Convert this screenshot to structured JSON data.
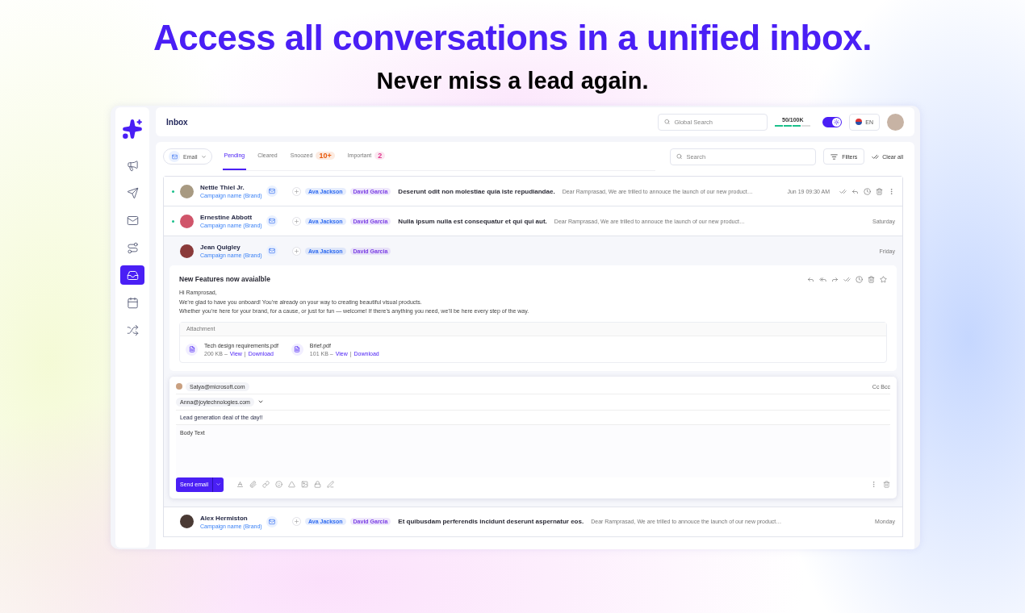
{
  "headline": "Access all conversations in a unified inbox.",
  "subheadline": "Never miss a lead again.",
  "sidebar": {
    "items": [
      {
        "kind": "megaphone",
        "selected": false
      },
      {
        "kind": "send",
        "selected": false
      },
      {
        "kind": "mail",
        "selected": false
      },
      {
        "kind": "route",
        "selected": false
      },
      {
        "kind": "inbox",
        "selected": true
      },
      {
        "kind": "calendar",
        "selected": false
      },
      {
        "kind": "shuffle",
        "selected": false
      }
    ]
  },
  "topbar": {
    "title": "Inbox",
    "search": {
      "placeholder": "Global Search"
    },
    "usage": {
      "reading": "50/100K",
      "level": 0.75
    },
    "toggle": {
      "on": true
    },
    "language": "EN"
  },
  "toolbar": {
    "channel": "Email",
    "tabs": [
      {
        "label": "Pending",
        "selected": true
      },
      {
        "label": "Cleared",
        "selected": false
      },
      {
        "label": "Snoozed",
        "selected": false,
        "badge": "10+",
        "color": "#e8590c"
      },
      {
        "label": "Important",
        "selected": false,
        "badge": "2",
        "color": "#e0368c"
      }
    ],
    "search": {
      "placeholder": "Search"
    },
    "filters": "Filters",
    "clear": "Clear all"
  },
  "messages": [
    {
      "name": "Nettie Thiel Jr.",
      "campaign": "Campaign name (Brand)",
      "unread": true,
      "hovered": true,
      "expanded": false,
      "tags": [
        {
          "label": "Ava Jackson",
          "color": "#2f6bf0"
        },
        {
          "label": "David Garcia",
          "color": "#7b3fe4"
        }
      ],
      "subject": "Deserunt odit non molestiae quia iste repudiandae.",
      "preview": "Dear Ramprasad, We are trilled to annouce the launch of our new product…",
      "time": "Jun 19  09:30 AM"
    },
    {
      "name": "Ernestine Abbott",
      "campaign": "Campaign name (Brand)",
      "unread": true,
      "hovered": false,
      "expanded": false,
      "tags": [
        {
          "label": "Ava Jackson",
          "color": "#2f6bf0"
        },
        {
          "label": "David Garcia",
          "color": "#7b3fe4"
        }
      ],
      "subject": "Nulla ipsum nulla est consequatur et qui qui aut.",
      "preview": "Dear Ramprasad, We are trilled to annouce the launch of our new product…",
      "time": "Saturday"
    },
    {
      "name": "Jean Quigley",
      "campaign": "Campaign name (Brand)",
      "unread": false,
      "hovered": false,
      "expanded": true,
      "tags": [
        {
          "label": "Ava Jackson",
          "color": "#2f6bf0"
        },
        {
          "label": "David Garcia",
          "color": "#7b3fe4"
        }
      ],
      "time": "Friday",
      "detail": {
        "subject": "New Features now avaialble",
        "body": [
          "Hi Ramprosad,",
          "We’re glad to have you onboard! You’re already on your way to creating beautiful visual products.",
          "Whether you’re here for your brand, for a cause, or just for fun — welcome! If there’s anything you need, we’ll be here every step of the way."
        ],
        "attachment_title": "Attachment",
        "files": [
          {
            "name": "Tech design requirements.pdf",
            "size": "200 KB –",
            "view": "View",
            "separator": "|",
            "download": "Download"
          },
          {
            "name": "Brief.pdf",
            "size": "101 KB –",
            "view": "View",
            "separator": "|",
            "download": "Download"
          }
        ]
      },
      "reply": {
        "from": "Satya@microsoft.com",
        "cc_bcc": "Cc Bcc",
        "to": "Anna@joytechnologies.com",
        "subject": "Lead generation deal of the day!!",
        "body": {
          "placeholder": "Body Text"
        },
        "send": "Send email"
      }
    },
    {
      "name": "Alex Hermiston",
      "campaign": "Campaign name (Brand)",
      "unread": false,
      "hovered": false,
      "expanded": false,
      "tags": [
        {
          "label": "Ava Jackson",
          "color": "#2f6bf0"
        },
        {
          "label": "David Garcia",
          "color": "#7b3fe4"
        }
      ],
      "subject": "Et quibusdam perferendis incidunt deserunt aspernatur eos.",
      "preview": "Dear Ramprasad, We are trilled to annouce the launch of our new product…",
      "time": "Monday"
    }
  ]
}
